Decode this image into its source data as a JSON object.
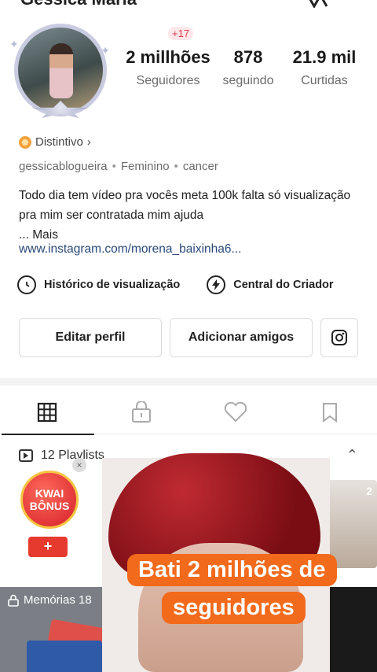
{
  "header": {
    "name_partial": "Gessica Maria"
  },
  "profile": {
    "stats": [
      {
        "value": "2 millhões",
        "label": "Seguidores",
        "badge": "+17"
      },
      {
        "value": "878",
        "label": "seguindo"
      },
      {
        "value": "21.9 mil",
        "label": "Curtidas"
      }
    ],
    "badge_label": "Distintivo",
    "badge_chevron": "›",
    "username": "gessicablogueira",
    "gender": "Feminino",
    "sign": "cancer",
    "meta_separator": "•",
    "bio": "Todo dia tem vídeo pra vocês meta 100k falta só visualização pra mim ser contratada mim ajuda",
    "bio_more": "... Mais",
    "link": "www.instagram.com/morena_baixinha6..."
  },
  "tools": {
    "history": "Histórico de visualização",
    "creator_center": "Central do Criador"
  },
  "buttons": {
    "edit_profile": "Editar perfil",
    "add_friends": "Adicionar amigos"
  },
  "content": {
    "playlists_label": "12 Playlists",
    "kwai_line1": "KWAI",
    "kwai_line2": "BÔNUS",
    "kwai_add": "+",
    "memories_label": "Memórias 18",
    "right_thumb_count": "2"
  },
  "caption": {
    "line1": "Bati 2 milhões de",
    "line2": "seguidores"
  },
  "colors": {
    "accent_red": "#e63a2e",
    "caption_orange": "#f26a1b",
    "link_blue": "#2b4a7a",
    "badge_pink": "#e33a4e"
  }
}
